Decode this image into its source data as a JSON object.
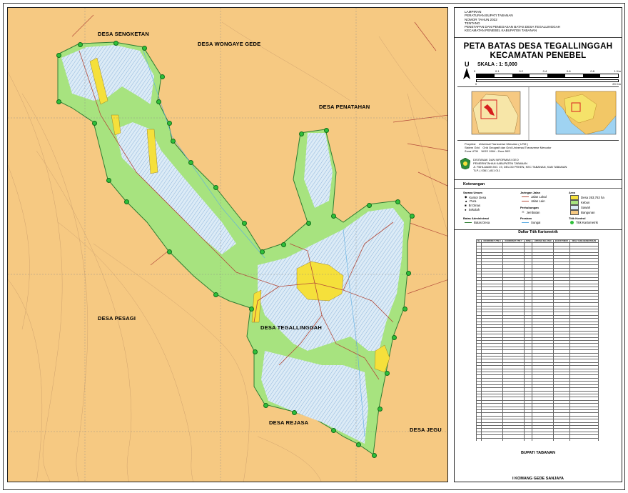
{
  "map": {
    "labels": {
      "sengketan": "DESA SENGKETAN",
      "wongaye": "DESA WONGAYE GEDE",
      "penatahan": "DESA PENATAHAN",
      "pesagi": "DESA PESAGI",
      "tegallinggah": "DESA TEGALLINGGAH",
      "rejasa": "DESA REJASA",
      "jegu": "DESA JEGU"
    },
    "colors": {
      "background": "#f6c982",
      "village_green": "#a7e37f",
      "rice_field": "#dcebf6",
      "hatch": "#7aa8d6",
      "settlement": "#f5e03b",
      "road": "#b34a3a",
      "boundary": "#2e7d32",
      "river": "#5dade2",
      "control_point": "#2fbf3a",
      "contour": "#c79a6a"
    }
  },
  "panel": {
    "lampiran": [
      "LAMPIRAN",
      "PERATURAN BUPATI TABANAN",
      "NOMOR      TAHUN 2022",
      "TENTANG",
      "PENETAPAN DAN PENEGASAN BATAS DESA TEGALLINGGAH",
      "KECAMATAN PENEBEL KABUPATEN TABANAN"
    ],
    "title_line1": "PETA BATAS DESA TEGALLINGGAH",
    "title_line2": "KECAMATAN PENEBEL",
    "north": "U",
    "scale_text": "SKALA : 1: 5,000",
    "scale_ticks": [
      "0",
      "0.1",
      "0.2",
      "0.4",
      "0.6",
      "0.8",
      "1 Km"
    ],
    "scale_ticks2": [
      "0",
      "20 Cm"
    ],
    "projection": [
      [
        "Proyeksi",
        "Universal Transverse Mercator ( UTM )"
      ],
      [
        "Sistem Grid",
        "Grid Geografi dan Grid Universal Transverse Mercator"
      ],
      [
        "Zona UTM",
        "WGS 1984 - Zone 50S"
      ]
    ],
    "agency": [
      "DISITANAK DAN INFORMASI GEO",
      "PEMERINTAHAN KABUPATEN TABANAN",
      "Jl. PAHLAWAN NO. 19, DELOD PEKEN, KEC TABANAN, KAB TABANAN",
      "TLP. ( 0361 ) 811 011"
    ],
    "keterangan": "Keterangan",
    "sarana_umum": "Sarana Umum",
    "sarana_items": [
      "Kantor Desa",
      "Pura",
      "Br Dinas",
      "Sekolah"
    ],
    "jaringan_jalan": "Jaringan Jalan",
    "jalan_items": [
      "Jalan Lokal",
      "Jalan Lain"
    ],
    "perhubungan": "Perhubungan",
    "perhubungan_items": [
      "Jembatan"
    ],
    "perairan": "Perairan",
    "perairan_items": [
      "Sungai"
    ],
    "area": "Area",
    "area_items": [
      "Desa 263,763 ha",
      "Kebun",
      "Sawah",
      "Bangunan"
    ],
    "batas_admin": "Batas Administrasi",
    "batas_items": [
      "Batas Desa"
    ],
    "titik_kontrol": "Titik Kontrol",
    "titik_items": [
      "Titik Kartometrik"
    ],
    "table_title": "Daftar Titik Kartometrik",
    "table_headers": [
      "No",
      "KOORDINAT UTM X",
      "KOORDINAT UTM Y",
      "ZONE",
      "LINTANG SELATAN",
      "BUJUR TIMUR",
      "DESA YANG BERBATASAN"
    ],
    "bupati": "BUPATI TABANAN",
    "signer": "I KOMANG GEDE SANJAYA"
  }
}
